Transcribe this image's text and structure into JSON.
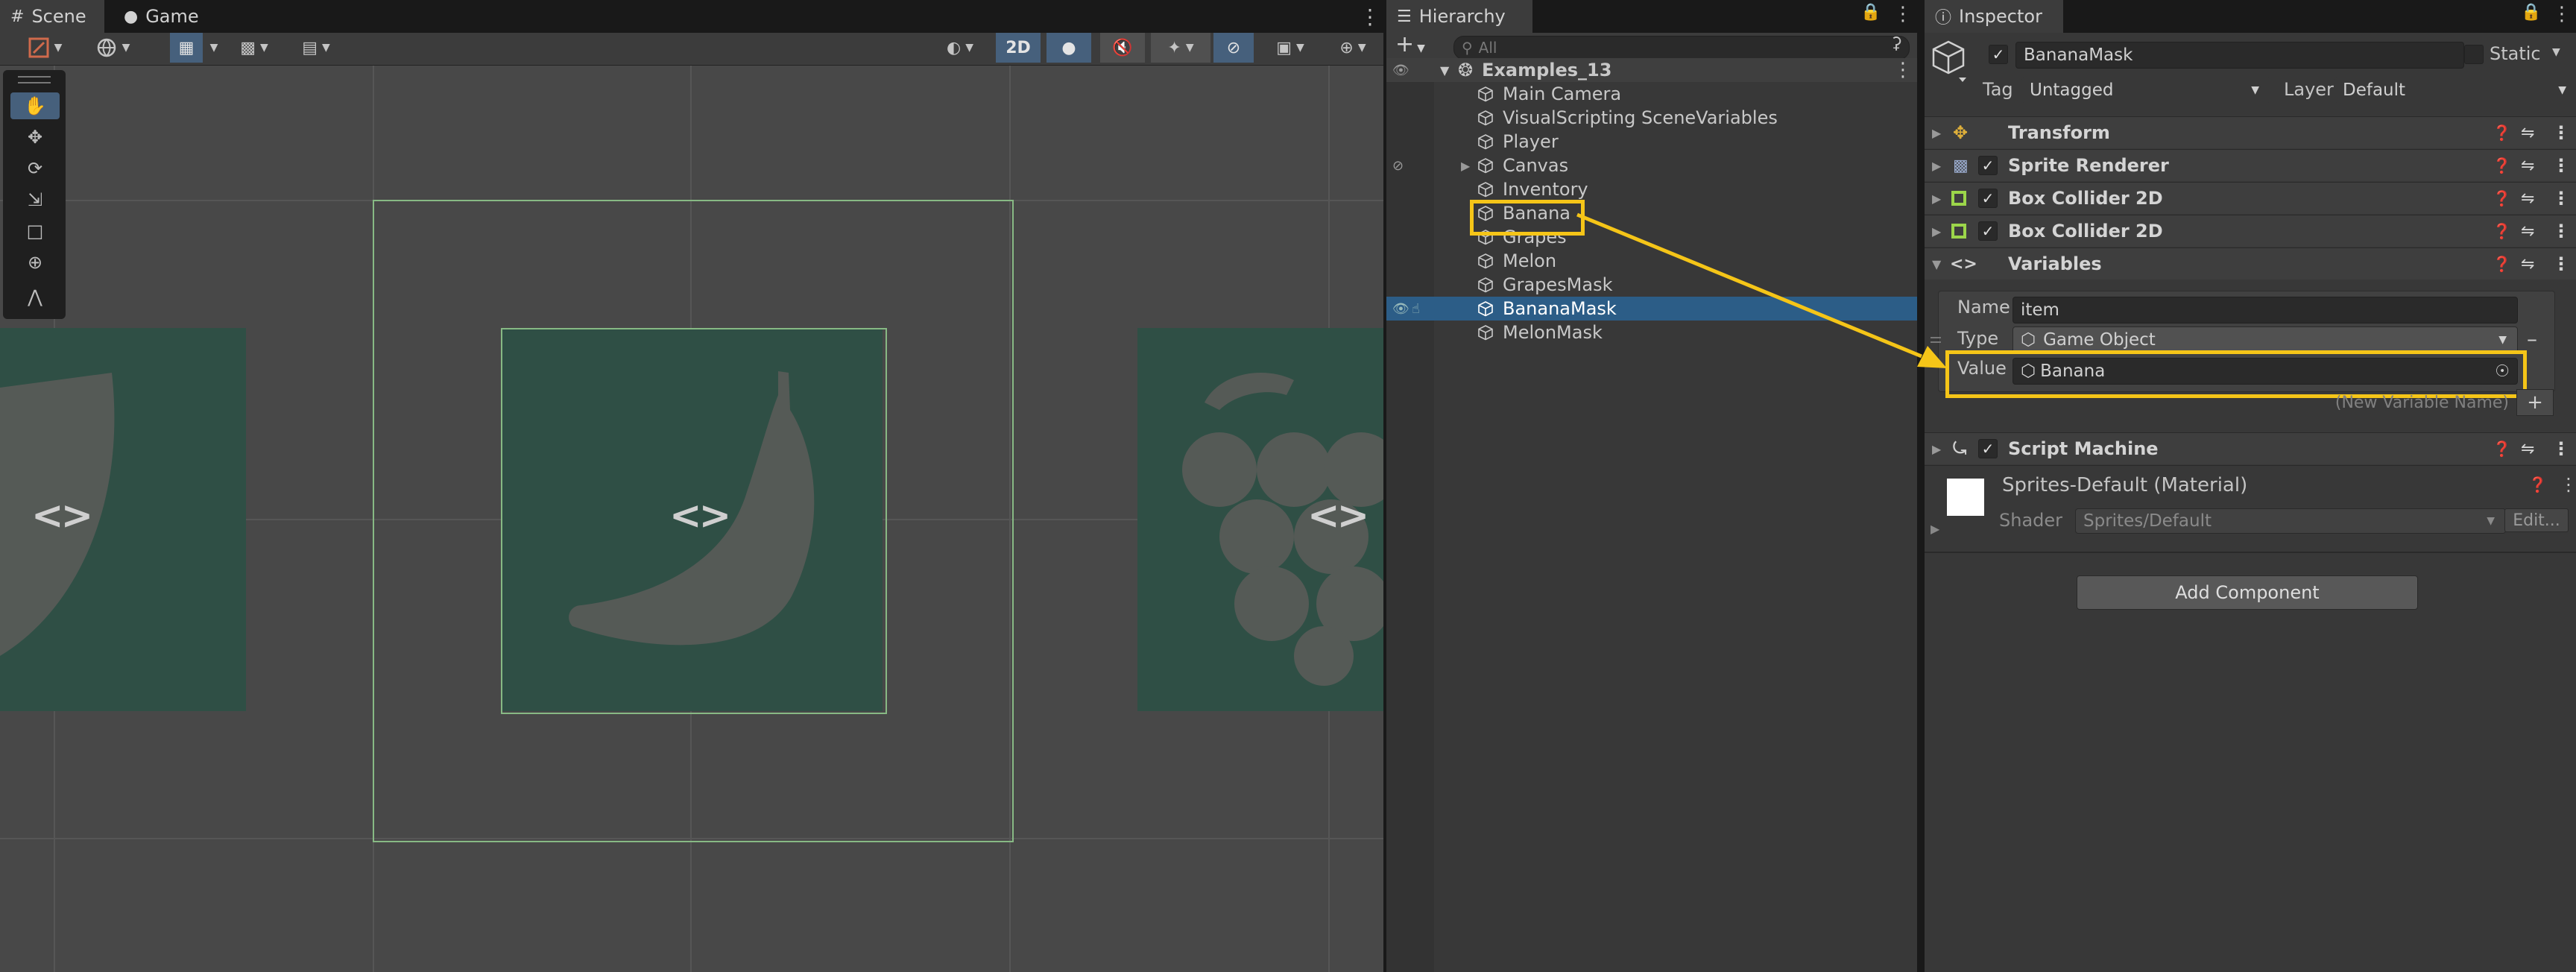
{
  "scene_tabs": [
    {
      "icon": "grid-icon",
      "label": "Scene"
    },
    {
      "icon": "gamepad-icon",
      "label": "Game"
    }
  ],
  "scene_toolbar": {
    "mode_2d_label": "2D"
  },
  "scene": {
    "variable_icon_glyph": "<>"
  },
  "hierarchy": {
    "tab_label": "Hierarchy",
    "search_placeholder": "All",
    "scene_name": "Examples_13",
    "items": [
      {
        "label": "Main Camera"
      },
      {
        "label": "VisualScripting SceneVariables"
      },
      {
        "label": "Player"
      },
      {
        "label": "Canvas"
      },
      {
        "label": "Inventory"
      },
      {
        "label": "Banana"
      },
      {
        "label": "Grapes"
      },
      {
        "label": "Melon"
      },
      {
        "label": "GrapesMask"
      },
      {
        "label": "BananaMask"
      },
      {
        "label": "MelonMask"
      }
    ],
    "selected_item": "BananaMask",
    "highlighted_item": "Banana"
  },
  "inspector": {
    "tab_label": "Inspector",
    "object_name": "BananaMask",
    "static_label": "Static",
    "tag_label": "Tag",
    "tag_value": "Untagged",
    "layer_label": "Layer",
    "layer_value": "Default",
    "components": [
      {
        "label": "Transform",
        "checkbox": false
      },
      {
        "label": "Sprite Renderer",
        "checkbox": true
      },
      {
        "label": "Box Collider 2D",
        "checkbox": true
      },
      {
        "label": "Box Collider 2D",
        "checkbox": true
      },
      {
        "label": "Variables",
        "checkbox": false
      }
    ],
    "variable": {
      "name_label": "Name",
      "name_value": "item",
      "type_label": "Type",
      "type_value": "Game Object",
      "value_label": "Value",
      "value_value": "Banana",
      "new_variable_placeholder": "(New Variable Name)"
    },
    "script_machine_label": "Script Machine",
    "material_label": "Sprites-Default (Material)",
    "shader_label": "Shader",
    "shader_value": "Sprites/Default",
    "edit_label": "Edit...",
    "add_component_label": "Add Component"
  },
  "colors": {
    "highlight": "#f5c518",
    "selection": "#2c5d87",
    "tile": "#2f4f45"
  }
}
